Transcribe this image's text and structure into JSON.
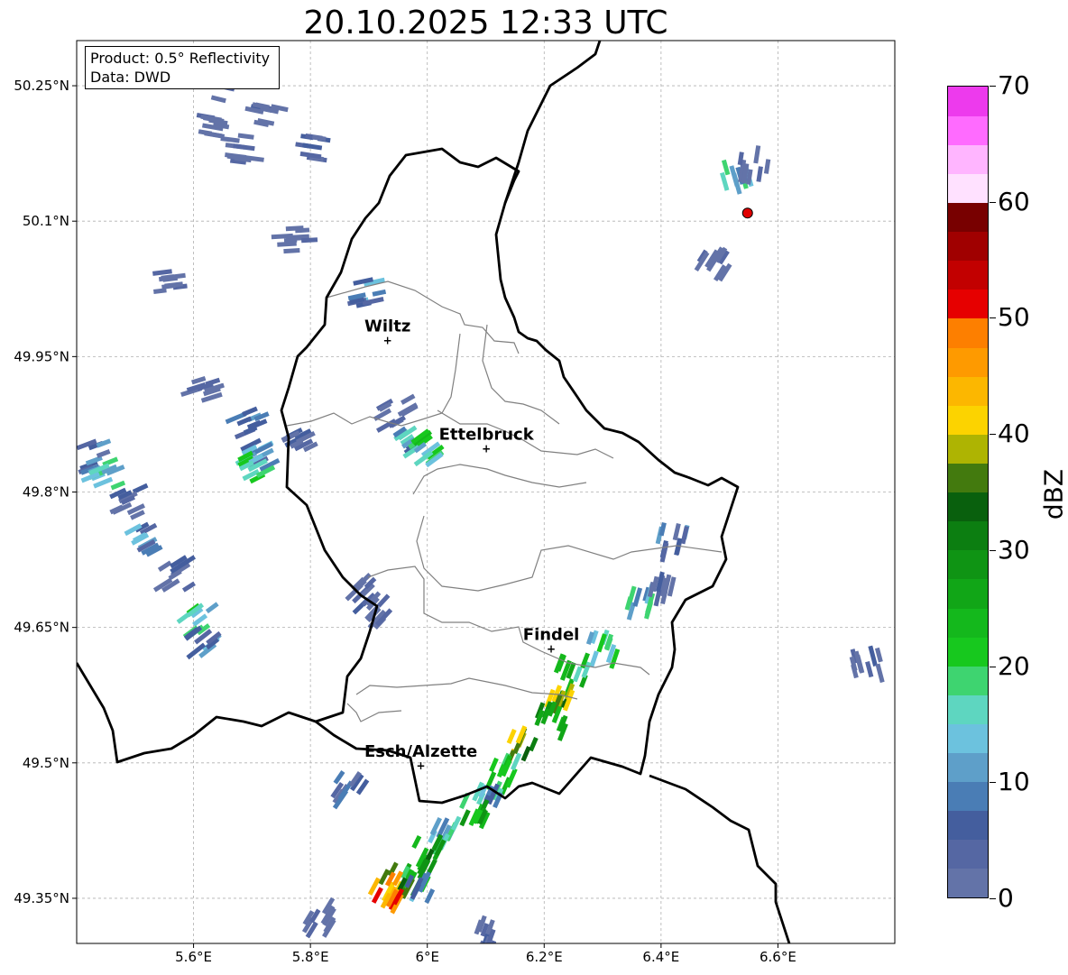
{
  "title": "20.10.2025 12:33 UTC",
  "info_box": {
    "product": "Product: 0.5° Reflectivity",
    "source": "Data: DWD"
  },
  "map": {
    "lon_range": [
      5.4,
      6.8
    ],
    "lat_range": [
      49.3,
      50.3
    ],
    "grid": true,
    "lon_ticks": [
      {
        "value": 5.6,
        "label": "5.6°E"
      },
      {
        "value": 5.8,
        "label": "5.8°E"
      },
      {
        "value": 6.0,
        "label": "6°E"
      },
      {
        "value": 6.2,
        "label": "6.2°E"
      },
      {
        "value": 6.4,
        "label": "6.4°E"
      },
      {
        "value": 6.6,
        "label": "6.6°E"
      }
    ],
    "lat_ticks": [
      {
        "value": 50.25,
        "label": "50.25°N"
      },
      {
        "value": 50.1,
        "label": "50.1°N"
      },
      {
        "value": 49.95,
        "label": "49.95°N"
      },
      {
        "value": 49.8,
        "label": "49.8°N"
      },
      {
        "value": 49.65,
        "label": "49.65°N"
      },
      {
        "value": 49.5,
        "label": "49.5°N"
      },
      {
        "value": 49.35,
        "label": "49.35°N"
      }
    ],
    "cities": [
      {
        "name": "Wiltz",
        "lon": 5.932,
        "lat": 49.968
      },
      {
        "name": "Ettelbruck",
        "lon": 6.101,
        "lat": 49.848
      },
      {
        "name": "Findel",
        "lon": 6.212,
        "lat": 49.626
      },
      {
        "name": "Esch/Alzette",
        "lon": 5.989,
        "lat": 49.497
      }
    ],
    "radar_site": {
      "lon": 6.548,
      "lat": 50.109,
      "color": "#e00000"
    }
  },
  "colorbar": {
    "label": "dBZ",
    "range": [
      0,
      70
    ],
    "ticks": [
      0,
      10,
      20,
      30,
      40,
      50,
      60,
      70
    ],
    "colors": [
      "#6373a8",
      "#5567a3",
      "#445e9e",
      "#4a7db5",
      "#5e9fc9",
      "#6cc2de",
      "#5ed6c0",
      "#3ed470",
      "#17c81e",
      "#14b81c",
      "#11a617",
      "#0f9414",
      "#0c7e11",
      "#09600d",
      "#437a0e",
      "#aeb402",
      "#fcd300",
      "#fcb700",
      "#fe9a00",
      "#fd7f00",
      "#e60000",
      "#c20000",
      "#a00000",
      "#780000",
      "#ffe1ff",
      "#ffb5ff",
      "#ff6bff",
      "#ed3aed"
    ]
  },
  "echoes": [
    {
      "lon": 5.66,
      "lat": 50.25,
      "dbz": 5
    },
    {
      "lon": 5.73,
      "lat": 50.22,
      "dbz": 6
    },
    {
      "lon": 5.69,
      "lat": 50.18,
      "dbz": 4
    },
    {
      "lon": 5.81,
      "lat": 50.18,
      "dbz": 7
    },
    {
      "lon": 5.64,
      "lat": 50.21,
      "dbz": 3
    },
    {
      "lon": 5.78,
      "lat": 50.08,
      "dbz": 4
    },
    {
      "lon": 5.56,
      "lat": 50.03,
      "dbz": 4
    },
    {
      "lon": 5.62,
      "lat": 49.92,
      "dbz": 5
    },
    {
      "lon": 5.7,
      "lat": 49.88,
      "dbz": 12
    },
    {
      "lon": 5.72,
      "lat": 49.84,
      "dbz": 16
    },
    {
      "lon": 5.71,
      "lat": 49.83,
      "dbz": 22
    },
    {
      "lon": 5.78,
      "lat": 49.86,
      "dbz": 7
    },
    {
      "lon": 5.44,
      "lat": 49.84,
      "dbz": 12
    },
    {
      "lon": 5.45,
      "lat": 49.82,
      "dbz": 21
    },
    {
      "lon": 5.49,
      "lat": 49.79,
      "dbz": 9
    },
    {
      "lon": 5.52,
      "lat": 49.75,
      "dbz": 14
    },
    {
      "lon": 5.57,
      "lat": 49.71,
      "dbz": 8
    },
    {
      "lon": 5.61,
      "lat": 49.66,
      "dbz": 22
    },
    {
      "lon": 5.62,
      "lat": 49.64,
      "dbz": 14
    },
    {
      "lon": 5.88,
      "lat": 49.69,
      "dbz": 6
    },
    {
      "lon": 5.92,
      "lat": 49.67,
      "dbz": 5
    },
    {
      "lon": 5.97,
      "lat": 49.86,
      "dbz": 18
    },
    {
      "lon": 6.0,
      "lat": 49.85,
      "dbz": 24
    },
    {
      "lon": 5.95,
      "lat": 49.89,
      "dbz": 6
    },
    {
      "lon": 5.9,
      "lat": 50.02,
      "dbz": 14
    },
    {
      "lon": 6.36,
      "lat": 49.68,
      "dbz": 20
    },
    {
      "lon": 6.4,
      "lat": 49.69,
      "dbz": 8
    },
    {
      "lon": 6.42,
      "lat": 49.75,
      "dbz": 12
    },
    {
      "lon": 6.49,
      "lat": 50.05,
      "dbz": 6
    },
    {
      "lon": 6.53,
      "lat": 50.15,
      "dbz": 20
    },
    {
      "lon": 6.56,
      "lat": 50.16,
      "dbz": 4
    },
    {
      "lon": 6.75,
      "lat": 49.61,
      "dbz": 6
    },
    {
      "lon": 6.3,
      "lat": 49.63,
      "dbz": 22
    },
    {
      "lon": 6.25,
      "lat": 49.6,
      "dbz": 28
    },
    {
      "lon": 6.23,
      "lat": 49.57,
      "dbz": 42
    },
    {
      "lon": 6.21,
      "lat": 49.55,
      "dbz": 32
    },
    {
      "lon": 6.16,
      "lat": 49.52,
      "dbz": 44
    },
    {
      "lon": 6.13,
      "lat": 49.49,
      "dbz": 26
    },
    {
      "lon": 6.1,
      "lat": 49.46,
      "dbz": 18
    },
    {
      "lon": 6.08,
      "lat": 49.45,
      "dbz": 30
    },
    {
      "lon": 6.03,
      "lat": 49.42,
      "dbz": 20
    },
    {
      "lon": 6.0,
      "lat": 49.4,
      "dbz": 33
    },
    {
      "lon": 5.98,
      "lat": 49.38,
      "dbz": 29
    },
    {
      "lon": 5.95,
      "lat": 49.37,
      "dbz": 45
    },
    {
      "lon": 5.93,
      "lat": 49.36,
      "dbz": 54
    },
    {
      "lon": 5.99,
      "lat": 49.36,
      "dbz": 16
    },
    {
      "lon": 6.11,
      "lat": 49.31,
      "dbz": 6
    },
    {
      "lon": 5.82,
      "lat": 49.33,
      "dbz": 5
    },
    {
      "lon": 5.87,
      "lat": 49.47,
      "dbz": 10
    }
  ]
}
